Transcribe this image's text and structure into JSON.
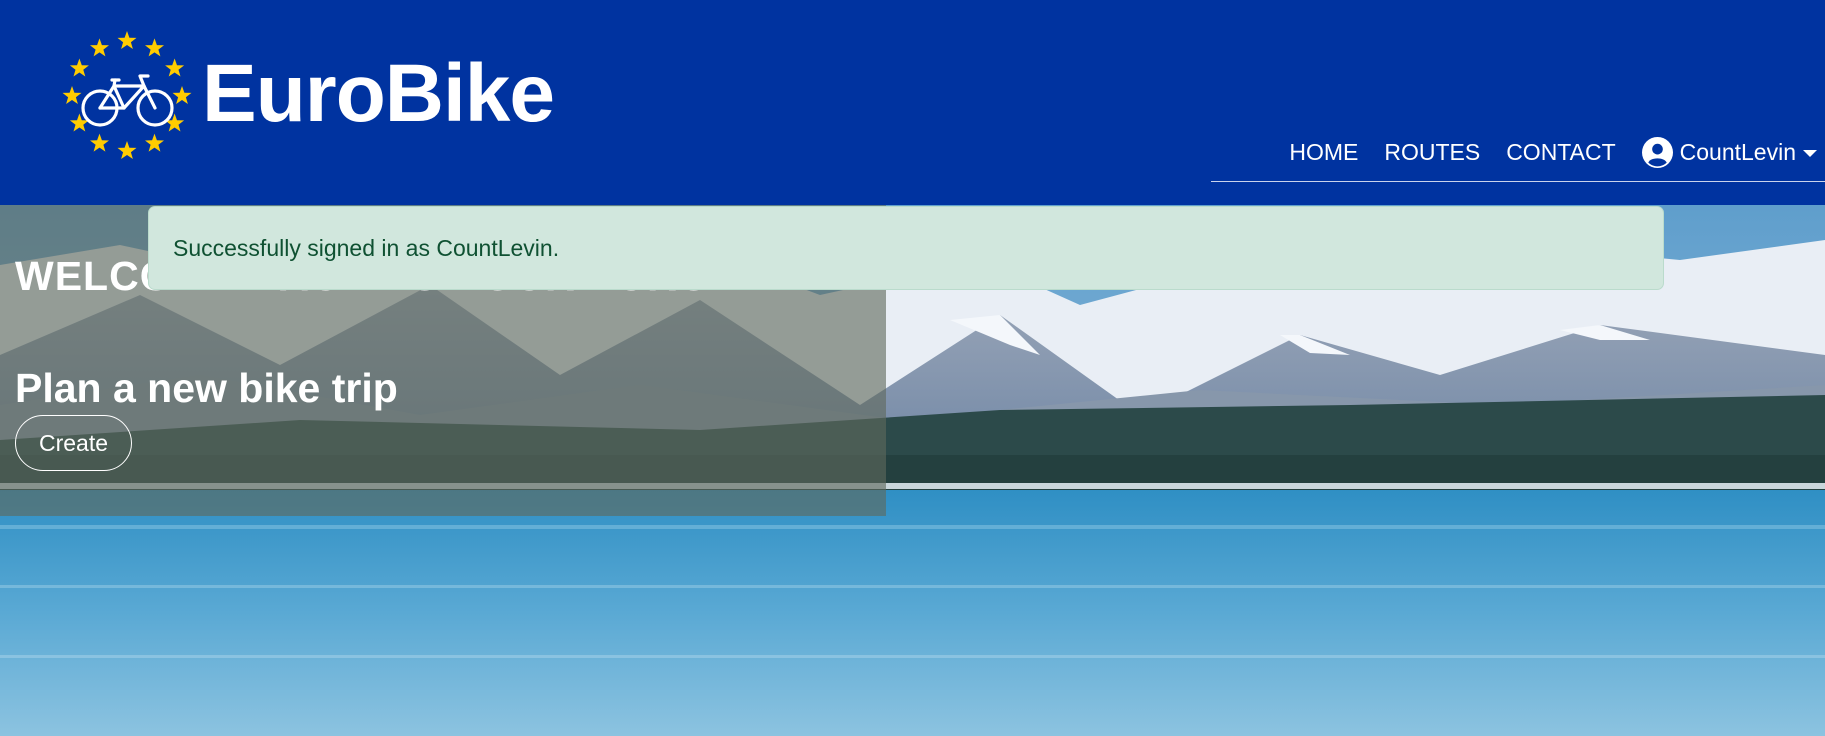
{
  "brand": {
    "name": "EuroBike",
    "logo_icon": "eu-stars-bicycle-icon",
    "star_color": "#ffcc00"
  },
  "nav": {
    "links": [
      "HOME",
      "ROUTES",
      "CONTACT"
    ],
    "user": {
      "icon": "user-circle-icon",
      "name": "CountLevin",
      "dropdown_icon": "caret-down-icon"
    }
  },
  "alert": {
    "message": "Successfully signed in as CountLevin.",
    "type": "success"
  },
  "hero": {
    "welcome": "WELCOME BACK TO YOUR EUROBIKE!",
    "plan_title": "Plan a new bike trip",
    "create_label": "Create",
    "background": "snowy-mountains-lake-photo"
  },
  "colors": {
    "header_bg": "#0033a0",
    "alert_bg": "#d1e7dd",
    "alert_text": "#0f5132"
  }
}
